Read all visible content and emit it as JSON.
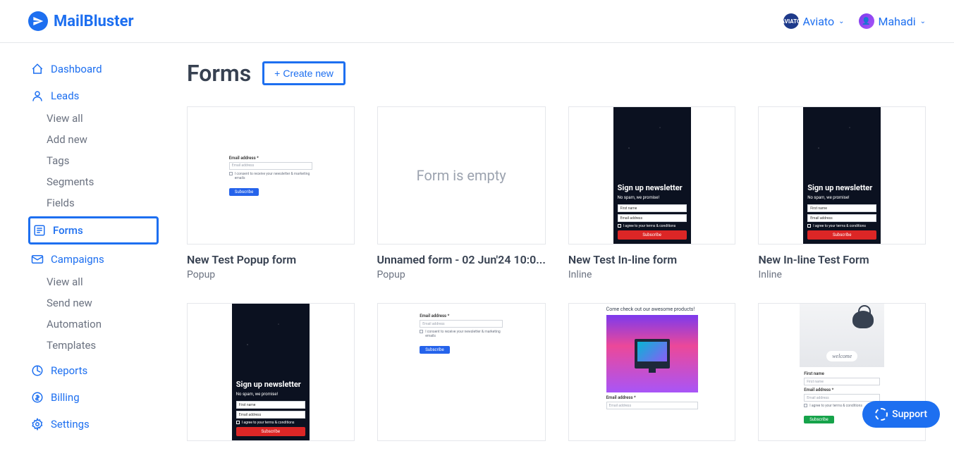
{
  "brand": {
    "name": "MailBluster"
  },
  "header": {
    "org": "Aviato",
    "org_avatar_text": "AVIATO",
    "user": "Mahadi"
  },
  "sidebar": {
    "dashboard": "Dashboard",
    "leads": {
      "label": "Leads",
      "view_all": "View all",
      "add_new": "Add new",
      "tags": "Tags",
      "segments": "Segments",
      "fields": "Fields"
    },
    "forms": "Forms",
    "campaigns": {
      "label": "Campaigns",
      "view_all": "View all",
      "send_new": "Send new",
      "automation": "Automation",
      "templates": "Templates"
    },
    "reports": "Reports",
    "billing": "Billing",
    "settings": "Settings"
  },
  "page": {
    "title": "Forms",
    "create_button": "Create new"
  },
  "forms": [
    {
      "title": "New Test Popup form",
      "type": "Popup"
    },
    {
      "title": "Unnamed form - 02 Jun'24 10:0...",
      "type": "Popup",
      "empty_text": "Form is empty"
    },
    {
      "title": "New Test In-line form",
      "type": "Inline"
    },
    {
      "title": "New In-line Test Form",
      "type": "Inline"
    },
    {
      "title": "",
      "type": ""
    },
    {
      "title": "",
      "type": ""
    },
    {
      "title": "",
      "type": ""
    },
    {
      "title": "",
      "type": ""
    }
  ],
  "preview_text": {
    "email_label": "Email address *",
    "email_placeholder": "Email address",
    "first_name_label": "First name",
    "first_name_placeholder": "First name",
    "consent": "I consent to receive your newsletter & marketing emails",
    "terms": "I agree to your terms & conditions",
    "subscribe": "Subscribe",
    "signup_title": "Sign up newsletter",
    "signup_sub": "No spam, we promise!",
    "product_headline": "Come check out our awesome products!",
    "welcome": "welcome"
  },
  "support": {
    "label": "Support"
  }
}
